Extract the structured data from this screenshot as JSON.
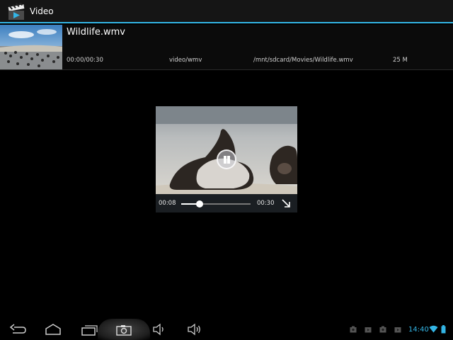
{
  "app": {
    "title": "Video"
  },
  "file": {
    "name": "Wildlife.wmv",
    "duration": "00:00/00:30",
    "mime": "video/wmv",
    "path": "/mnt/sdcard/Movies/Wildlife.wmv",
    "size": "25 M"
  },
  "player": {
    "current_time": "00:08",
    "total_time": "00:30",
    "progress_fraction": 0.27,
    "state": "playing",
    "icons": {
      "pause": "pause-icon",
      "fullscreen": "fullscreen-icon"
    }
  },
  "system_bar": {
    "clock": "14:40",
    "nav_icons": [
      "back-icon",
      "home-icon",
      "recent-apps-icon",
      "screenshot-icon",
      "volume-down-icon",
      "volume-up-icon"
    ],
    "notification_icons": [
      "media-notification-icon",
      "media-notification-icon",
      "media-notification-icon",
      "media-notification-icon"
    ],
    "status_icons": [
      "wifi-icon",
      "battery-icon"
    ],
    "accent_color": "#33b5e5"
  }
}
